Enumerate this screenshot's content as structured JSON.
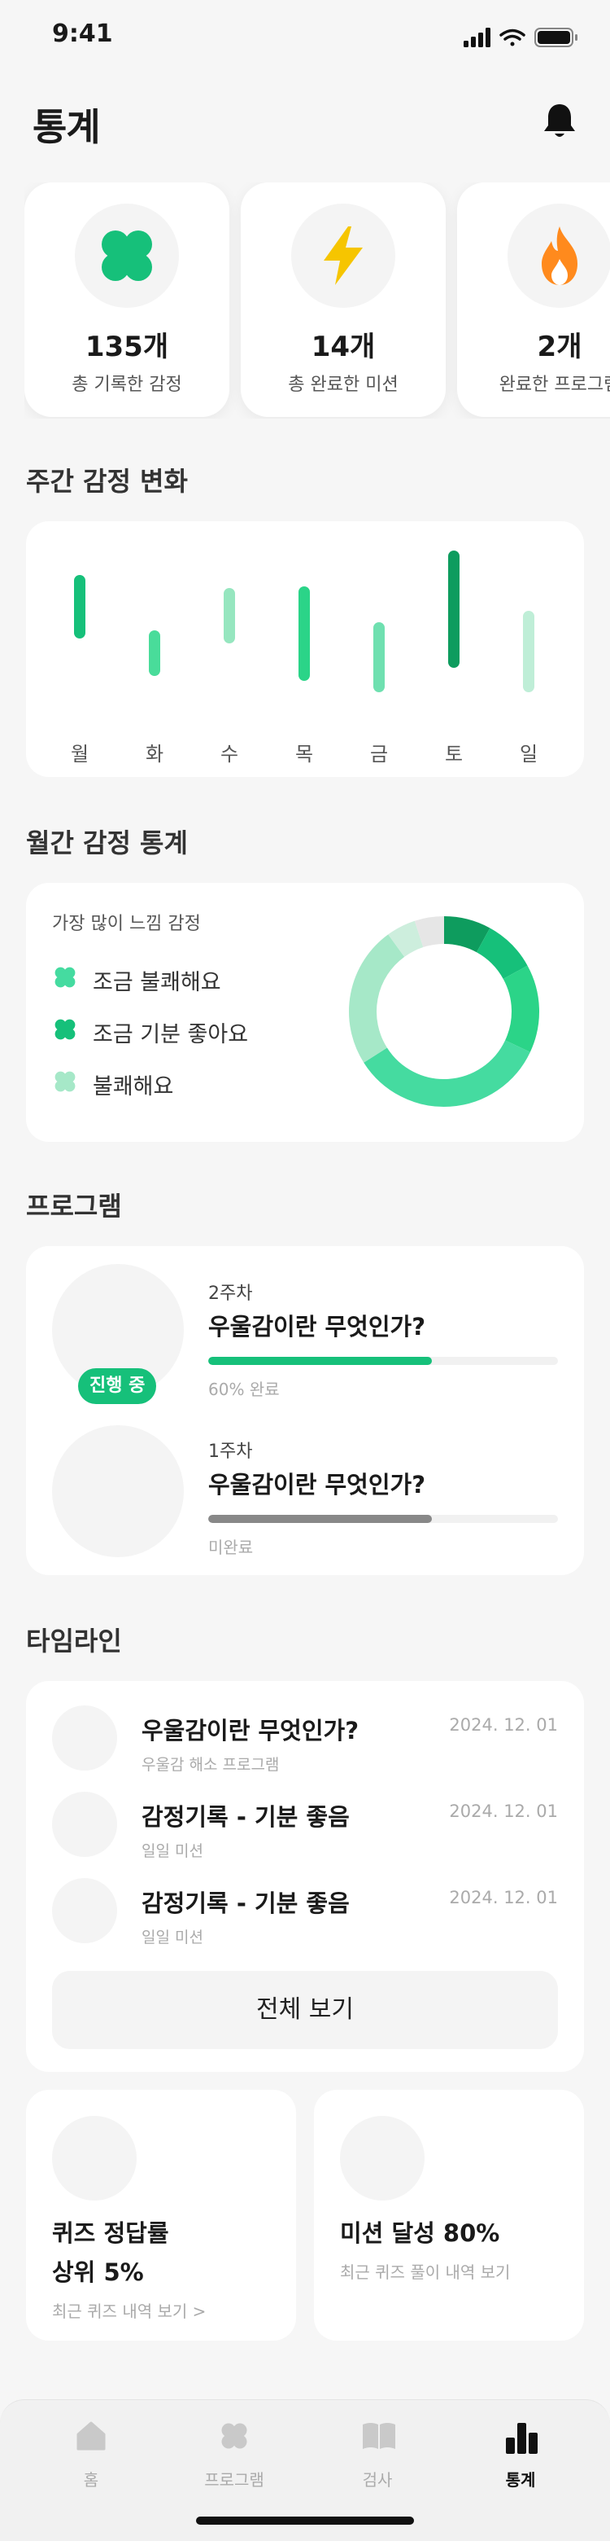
{
  "status": {
    "time": "9:41"
  },
  "header": {
    "title": "통계"
  },
  "summary": [
    {
      "value": "135개",
      "label": "총 기록한 감정",
      "icon": "clover-icon"
    },
    {
      "value": "14개",
      "label": "총 완료한 미션",
      "icon": "lightning-icon"
    },
    {
      "value": "2개",
      "label": "완료한 프로그램",
      "icon": "fire-icon"
    }
  ],
  "weekly": {
    "title": "주간 감정 변화",
    "chart_data": {
      "type": "range-bar",
      "categories": [
        "월",
        "화",
        "수",
        "목",
        "금",
        "토",
        "일"
      ],
      "colors": [
        "#16c07a",
        "#49dc9a",
        "#96e6bf",
        "#2bd488",
        "#6fe0b0",
        "#0e9c5e",
        "#bfeed7"
      ]
    }
  },
  "monthly": {
    "title": "월간 감정 통계",
    "subtitle": "가장 많이 느낌 감정",
    "legend": [
      {
        "label": "조금 불쾌해요",
        "color": "#45dba0"
      },
      {
        "label": "조금 기분 좋아요",
        "color": "#16c07a"
      },
      {
        "label": "불쾌해요",
        "color": "#a6e8c8"
      }
    ],
    "chart_data": {
      "type": "pie",
      "segments": [
        {
          "value": 8,
          "color": "#0e9c5e"
        },
        {
          "value": 9,
          "color": "#16c07a"
        },
        {
          "value": 15,
          "color": "#2bd488"
        },
        {
          "value": 34,
          "color": "#45dba0"
        },
        {
          "value": 24,
          "color": "#a6e8c8"
        },
        {
          "value": 5,
          "color": "#cdeedd"
        },
        {
          "value": 5,
          "color": "#e6e6e6"
        }
      ]
    }
  },
  "program": {
    "title": "프로그램",
    "items": [
      {
        "week": "2주차",
        "title": "우울감이란 무엇인가?",
        "status": "60% 완료",
        "progress": 0.64,
        "color": "#16c07a",
        "badge": "진행 중"
      },
      {
        "week": "1주차",
        "title": "우울감이란 무엇인가?",
        "status": "미완료",
        "progress": 0.64,
        "color": "#888888"
      }
    ]
  },
  "timeline": {
    "title": "타임라인",
    "items": [
      {
        "title": "우울감이란 무엇인가?",
        "sub": "우울감 해소 프로그램",
        "date": "2024. 12. 01"
      },
      {
        "title": "감정기록 - 기분 좋음",
        "sub": "일일 미션",
        "date": "2024. 12. 01"
      },
      {
        "title": "감정기록 - 기분 좋음",
        "sub": "일일 미션",
        "date": "2024. 12. 01"
      }
    ],
    "view_all": "전체 보기"
  },
  "quiz": {
    "title_line1": "퀴즈 정답률",
    "title_line2": "상위 5%",
    "link": "최근 퀴즈 내역 보기 >"
  },
  "mission": {
    "title": "미션 달성 80%",
    "link": "최근 퀴즈 풀이 내역 보기"
  },
  "tabs": [
    {
      "label": "홈",
      "icon": "home-icon"
    },
    {
      "label": "프로그램",
      "icon": "clover-icon"
    },
    {
      "label": "검사",
      "icon": "book-icon"
    },
    {
      "label": "통계",
      "icon": "bar-chart-icon",
      "active": true
    }
  ]
}
